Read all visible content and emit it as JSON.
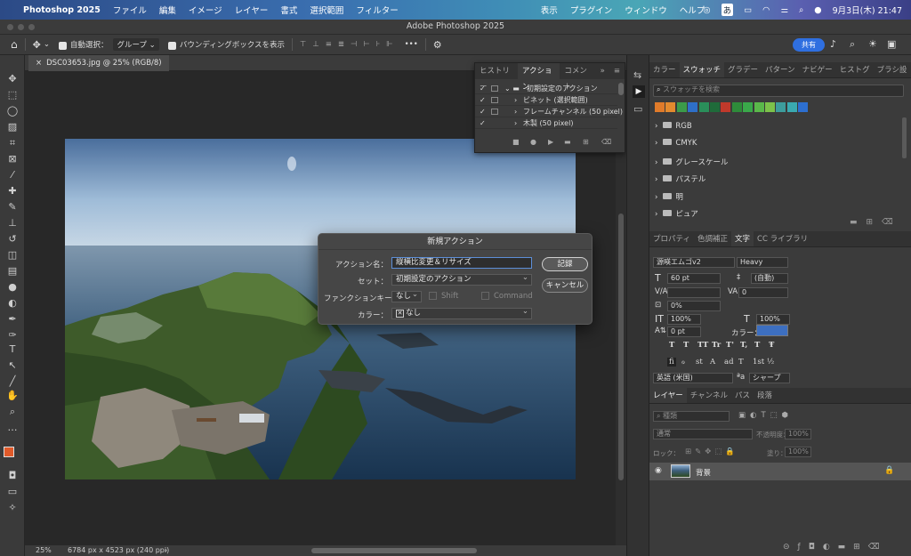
{
  "menubar": {
    "apple": "",
    "app": "Photoshop 2025",
    "items": [
      "ファイル",
      "編集",
      "イメージ",
      "レイヤー",
      "書式",
      "選択範囲",
      "フィルター"
    ],
    "right_items": [
      "表示",
      "プラグイン",
      "ウィンドウ",
      "ヘルプ"
    ],
    "ime": "あ",
    "clock": "9月3日(木) 21:47"
  },
  "window": {
    "title": "Adobe Photoshop 2025"
  },
  "options": {
    "auto_select": "自動選択：",
    "group": "グループ",
    "bbox": "バウンディングボックスを表示",
    "share": "共有",
    "more": "•••"
  },
  "document": {
    "tab": "DSC03653.jpg @ 25% (RGB/8)",
    "zoom": "25%",
    "info": "6784 px x 4523 px (240 ppi)"
  },
  "actions_panel": {
    "tabs": [
      "ヒストリー",
      "アクション",
      "コメント"
    ],
    "active": "アクション",
    "rows": [
      {
        "check": "✓",
        "label": "初期設定のアクション",
        "level": 0
      },
      {
        "check": "✓",
        "label": "ビネット (選択範囲)",
        "level": 1
      },
      {
        "check": "✓",
        "label": "フレームチャンネル (50 pixel)",
        "level": 1
      },
      {
        "check": "✓",
        "label": "木製 (50 pixel)",
        "level": 1
      }
    ]
  },
  "dialog": {
    "title": "新規アクション",
    "name_label": "アクション名：",
    "name_value": "縦横比変更＆リサイズ",
    "set_label": "セット：",
    "set_value": "初期設定のアクション",
    "fkey_label": "ファンクションキー：",
    "fkey_value": "なし",
    "shift_label": "Shift",
    "command_label": "Command",
    "color_label": "カラー：",
    "color_value": "なし",
    "record_button": "記録",
    "cancel_button": "キャンセル"
  },
  "swatches_panel": {
    "tabs": [
      "カラー",
      "スウォッチ",
      "グラデー",
      "パターン",
      "ナビゲー",
      "ヒストグ",
      "ブラシ設"
    ],
    "active": "スウォッチ",
    "search_placeholder": "スウォッチを検索",
    "colors": [
      "#e07b2a",
      "#e38a2e",
      "#3b9b4a",
      "#2e6fc8",
      "#2a8f5a",
      "#1f6b3a",
      "#c0392b",
      "#2e8b3a",
      "#3aa84a",
      "#5ab84a",
      "#7cc24a",
      "#3d9c9c",
      "#3aa9b0",
      "#2d6fd0"
    ],
    "folders": [
      "RGB",
      "CMYK",
      "グレースケール",
      "パステル",
      "明",
      "ピュア"
    ]
  },
  "props_panel": {
    "tabs": [
      "プロパティ",
      "色調補正",
      "文字",
      "CC ライブラリ"
    ],
    "active": "文字",
    "font": "源暎エムゴv2",
    "weight": "Heavy",
    "size": "60 pt",
    "leading": "(自動)",
    "tracking": "0",
    "kerning_value": "0%",
    "vscale": "100%",
    "hscale": "100%",
    "baseline": "0 pt",
    "color_label": "カラー：",
    "color": "#3d6fc0",
    "language": "英語 (米国)",
    "aa_label": "シャープ",
    "style_buttons": [
      "T",
      "T",
      "TT",
      "Tr",
      "T'",
      "T,",
      "T",
      "Ŧ"
    ],
    "otf_buttons": [
      "fi",
      "ℴ",
      "st",
      "A",
      "ad",
      "T",
      "1st",
      "½"
    ]
  },
  "layers_panel": {
    "tabs": [
      "レイヤー",
      "チャンネル",
      "パス",
      "段落"
    ],
    "active": "レイヤー",
    "filter_placeholder": "種類",
    "blend": "通常",
    "opacity_label": "不透明度：",
    "opacity": "100%",
    "lock_label": "ロック：",
    "fill_label": "塗り：",
    "fill": "100%",
    "layer_name": "背景"
  }
}
